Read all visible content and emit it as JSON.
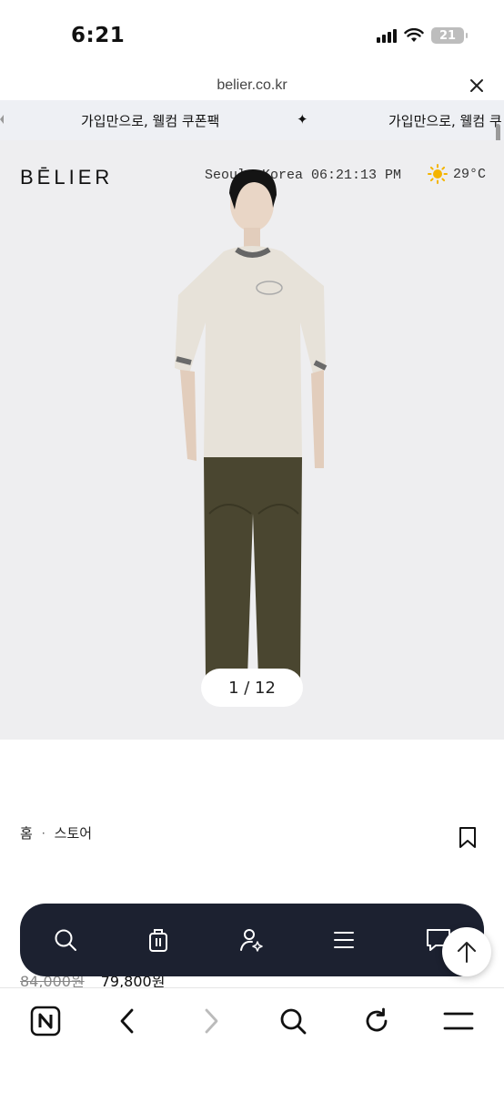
{
  "status_bar": {
    "time": "6:21",
    "battery": "21"
  },
  "browser": {
    "url": "belier.co.kr"
  },
  "banner": {
    "promo_text": "가입만으로, 웰컴 쿠폰팩",
    "promo_text_partial": "가입만으로, 웰컴 쿠",
    "separator": "✦"
  },
  "header": {
    "logo": "BĒLIER",
    "location_time": "Seoul, Korea  06:21:13 PM",
    "temperature": "29°C"
  },
  "gallery": {
    "pager": "1 / 12"
  },
  "breadcrumb": {
    "home": "홈",
    "separator": "·",
    "store": "스토어"
  },
  "product": {
    "original_price": "84,000원",
    "sale_price": "79,800원"
  },
  "floating_nav": {
    "chat_label": "CHAT"
  },
  "colors": {
    "nav_bg": "#1c2130",
    "hero_bg": "#eeeef0",
    "banner_bg": "#eef0f4"
  }
}
